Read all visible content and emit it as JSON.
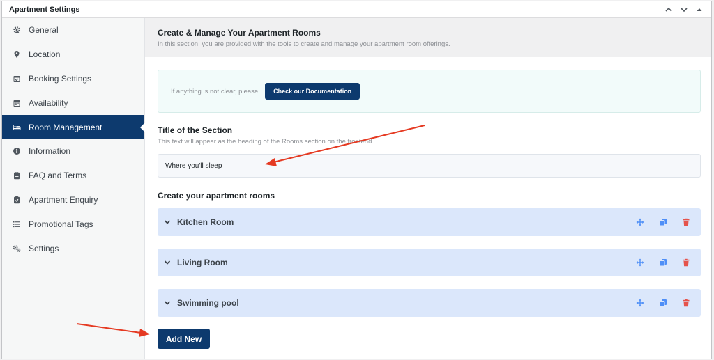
{
  "panel": {
    "title": "Apartment Settings"
  },
  "sidebar": {
    "items": [
      {
        "label": "General",
        "icon": "gear-icon"
      },
      {
        "label": "Location",
        "icon": "map-pin-icon"
      },
      {
        "label": "Booking Settings",
        "icon": "calendar-check-icon"
      },
      {
        "label": "Availability",
        "icon": "calendar-icon"
      },
      {
        "label": "Room Management",
        "icon": "bed-icon",
        "active": true
      },
      {
        "label": "Information",
        "icon": "info-icon"
      },
      {
        "label": "FAQ and Terms",
        "icon": "clipboard-icon"
      },
      {
        "label": "Apartment Enquiry",
        "icon": "clipboard-check-icon"
      },
      {
        "label": "Promotional Tags",
        "icon": "list-icon"
      },
      {
        "label": "Settings",
        "icon": "gears-icon"
      }
    ]
  },
  "main": {
    "heading": "Create & Manage Your Apartment Rooms",
    "subheading": "In this section, you are provided with the tools to create and manage your apartment room offerings.",
    "doc_text": "If anything is not clear, please",
    "doc_button": "Check our Documentation",
    "section_title_label": "Title of the Section",
    "section_title_desc": "This text will appear as the heading of the Rooms section on the frontend.",
    "section_title_value": "Where you'll sleep",
    "rooms_label": "Create your apartment rooms",
    "rooms": [
      {
        "name": "Kitchen Room"
      },
      {
        "name": "Living Room"
      },
      {
        "name": "Swimming pool"
      }
    ],
    "add_button": "Add New"
  },
  "colors": {
    "accent": "#0d3a6e",
    "room_bg": "#dbe7fb",
    "delete": "#e5534b",
    "action_icon": "#4f8ff7",
    "annotation_arrow": "#e53a22"
  }
}
